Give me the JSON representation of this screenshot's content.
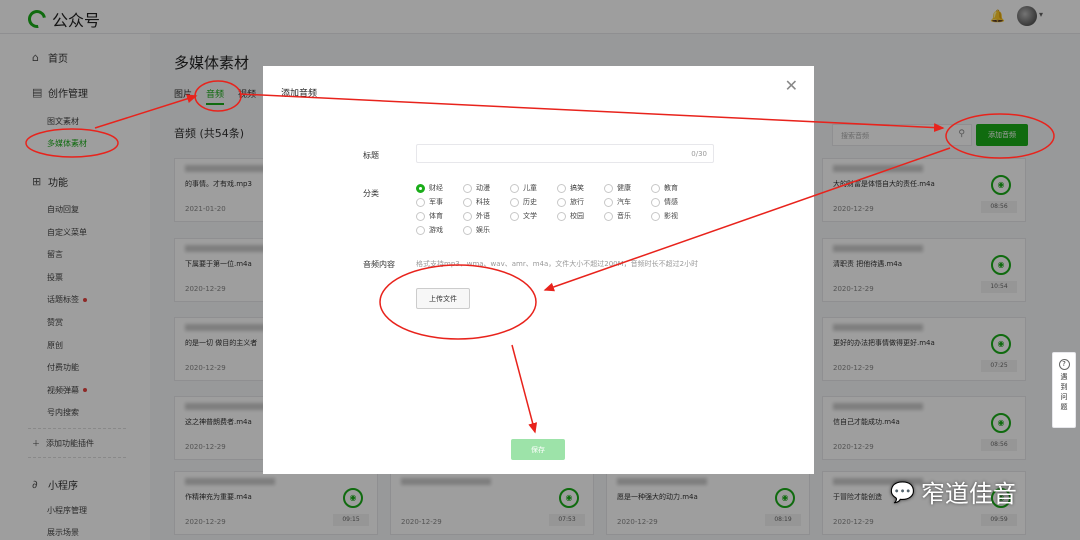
{
  "app": {
    "title": "公众号"
  },
  "sidebar": {
    "home": "首页",
    "creation": "创作管理",
    "creation_items": [
      "图文素材",
      "多媒体素材"
    ],
    "features": "功能",
    "feature_items": [
      {
        "label": "自动回复",
        "dot": false
      },
      {
        "label": "自定义菜单",
        "dot": false
      },
      {
        "label": "留言",
        "dot": false
      },
      {
        "label": "投票",
        "dot": false
      },
      {
        "label": "话题标签",
        "dot": true
      },
      {
        "label": "赞赏",
        "dot": false
      },
      {
        "label": "原创",
        "dot": false
      },
      {
        "label": "付费功能",
        "dot": false
      },
      {
        "label": "视频弹幕",
        "dot": true
      },
      {
        "label": "号内搜索",
        "dot": false
      }
    ],
    "add_plugin": "添加功能插件",
    "mini_program": "小程序",
    "mini_items": [
      "小程序管理",
      "展示场景"
    ]
  },
  "main": {
    "title": "多媒体素材",
    "tabs": [
      "图片",
      "音频",
      "视频"
    ],
    "count": "音频  (共54条)",
    "search_placeholder": "搜索音频",
    "add_button": "添加音频"
  },
  "cards": [
    {
      "title": "的事情。才有戏.mp3",
      "date": "2021-01-20",
      "dur": ""
    },
    {
      "title": "大的财富是体悟自大的责任.m4a",
      "date": "2020-12-29",
      "dur": "08:56"
    },
    {
      "title": "下属要于第一位.m4a",
      "date": "2020-12-29",
      "dur": ""
    },
    {
      "title": "清职责 把他待遇.m4a",
      "date": "2020-12-29",
      "dur": "10:54"
    },
    {
      "title": "的是一切 做目的主义者",
      "date": "2020-12-29",
      "dur": ""
    },
    {
      "title": "更好的办法把事情做得更好.m4a",
      "date": "2020-12-29",
      "dur": "07:25"
    },
    {
      "title": "这之神普朗费者.m4a",
      "date": "2020-12-29",
      "dur": ""
    },
    {
      "title": "信自己才能成功.m4a",
      "date": "2020-12-29",
      "dur": "08:56"
    },
    {
      "title": "作精神充为重要.m4a",
      "date": "2020-12-29",
      "dur": "09:15"
    },
    {
      "title": "",
      "date": "2020-12-29",
      "dur": "07:53"
    },
    {
      "title": "愿是一种强大的动力.m4a",
      "date": "2020-12-29",
      "dur": "08:19"
    },
    {
      "title": "于冒险才能创造",
      "date": "2020-12-29",
      "dur": "09:59"
    }
  ],
  "dialog": {
    "title": "添加音频",
    "label_title": "标题",
    "title_counter": "0/30",
    "label_category": "分类",
    "categories": [
      "财经",
      "动漫",
      "儿童",
      "搞笑",
      "健康",
      "教育",
      "军事",
      "科技",
      "历史",
      "旅行",
      "汽车",
      "情感",
      "体育",
      "外语",
      "文学",
      "校园",
      "音乐",
      "影视",
      "游戏",
      "娱乐"
    ],
    "selected_category": "财经",
    "label_content": "音频内容",
    "hint": "格式支持mp3、wma、wav、amr、m4a，文件大小不超过200M，音频时长不超过2小时",
    "upload": "上传文件",
    "save": "保存"
  },
  "help": {
    "label": "遇到问题"
  },
  "watermark": {
    "text": "窄道佳音"
  },
  "colors": {
    "brand": "#1aad19",
    "annotation": "#e8231c"
  }
}
